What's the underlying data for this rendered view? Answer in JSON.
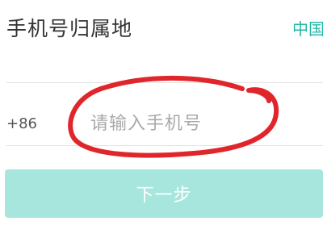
{
  "region": {
    "label": "手机号归属地",
    "value": "中国"
  },
  "phone": {
    "country_code": "+86",
    "placeholder": "请输入手机号",
    "value": ""
  },
  "actions": {
    "next_label": "下一步"
  },
  "colors": {
    "accent": "#1fb8a4",
    "button_disabled": "#a7e6dd",
    "annotation_red": "#e0262b"
  }
}
